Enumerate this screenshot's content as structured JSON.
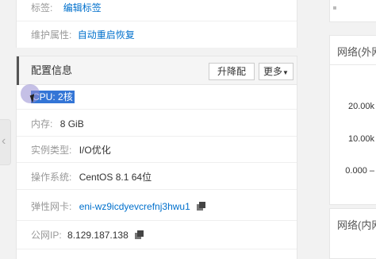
{
  "basic": {
    "tags_label": "标签:",
    "tags_value": "编辑标签",
    "maintenance_label": "维护属性:",
    "maintenance_value": "自动重启恢复"
  },
  "config": {
    "title": "配置信息",
    "upgrade_button": "升降配",
    "more_button": "更多",
    "cpu_label": "CPU:",
    "cpu_value": "2核",
    "memory_label": "内存:",
    "memory_value": "8 GiB",
    "instance_type_label": "实例类型:",
    "instance_type_value": "I/O优化",
    "os_label": "操作系统:",
    "os_value": "CentOS 8.1 64位",
    "eni_label": "弹性网卡:",
    "eni_value": "eni-wz9icdyevcrefnj3hwu1",
    "public_ip_label": "公网IP:",
    "public_ip_value": "8.129.187.138"
  },
  "right_panel": {
    "chart1_title": "网络(外网",
    "chart1_ticks": [
      "20.00k",
      "10.00k",
      "0.000 –"
    ],
    "chart2_title": "网络(内网"
  }
}
